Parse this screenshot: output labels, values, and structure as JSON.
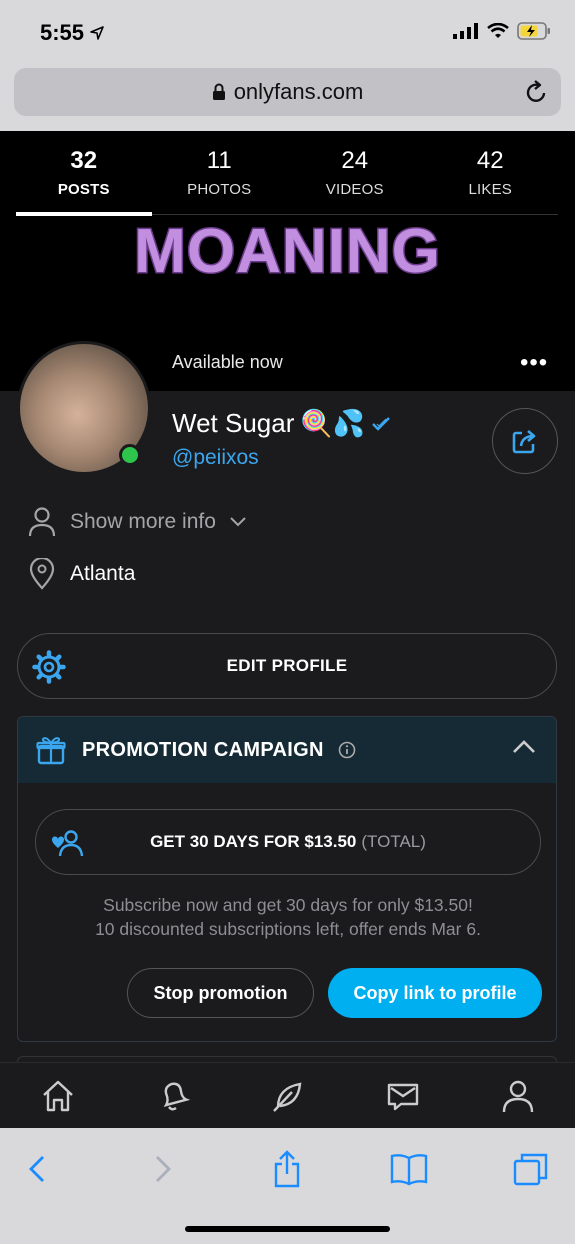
{
  "status_bar": {
    "time": "5:55"
  },
  "browser": {
    "url": "onlyfans.com"
  },
  "stats": [
    {
      "count": "32",
      "label": "POSTS",
      "active": true
    },
    {
      "count": "11",
      "label": "PHOTOS",
      "active": false
    },
    {
      "count": "24",
      "label": "VIDEOS",
      "active": false
    },
    {
      "count": "42",
      "label": "LIKES",
      "active": false
    }
  ],
  "cover": {
    "text": "MOANING"
  },
  "profile": {
    "availability": "Available now",
    "name": "Wet Sugar",
    "name_emoji": "🍭💦",
    "handle": "@peiixos",
    "show_more_label": "Show more info",
    "location": "Atlanta"
  },
  "edit_profile_label": "EDIT PROFILE",
  "promotion": {
    "title": "PROMOTION CAMPAIGN",
    "offer_main": "GET 30 DAYS FOR $13.50",
    "offer_suffix": "(TOTAL)",
    "description_line1": "Subscribe now and get 30 days for only $13.50!",
    "description_line2": "10 discounted subscriptions left, offer ends Mar 6.",
    "stop_label": "Stop promotion",
    "copy_label": "Copy link to profile"
  },
  "colors": {
    "accent": "#00aff0",
    "online": "#2ec54c",
    "cover_text": "#c28fe0"
  }
}
